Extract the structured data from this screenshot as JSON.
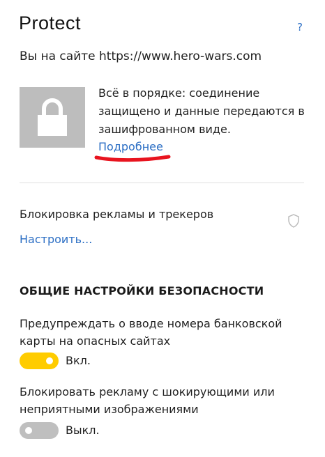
{
  "header": {
    "title": "Protect",
    "help_label": "?"
  },
  "site": {
    "text": "Вы на сайте https://www.hero-wars.com"
  },
  "connection": {
    "status_text": "Всё в порядке: соединение защищено и данные передаются в зашифрованном виде.",
    "more_link": "Подробнее",
    "lock_icon": "lock-icon",
    "annotation_color": "#e8141f"
  },
  "ads_block": {
    "title": "Блокировка рекламы и трекеров",
    "configure_link": "Настроить...",
    "icon": "shield-icon"
  },
  "general_security": {
    "heading": "ОБЩИЕ НАСТРОЙКИ БЕЗОПАСНОСТИ",
    "options": [
      {
        "label": "Предупреждать о вводе номера банковской карты на опасных сайтах",
        "state": "Вкл.",
        "enabled": true
      },
      {
        "label": "Блокировать рекламу с шокирующими или неприятными изображениями",
        "state": "Выкл.",
        "enabled": false
      }
    ]
  },
  "colors": {
    "link": "#2b6ec4",
    "toggle_on": "#ffcc00",
    "toggle_off": "#bfbfbf",
    "lock_bg": "#bdbdbd"
  }
}
